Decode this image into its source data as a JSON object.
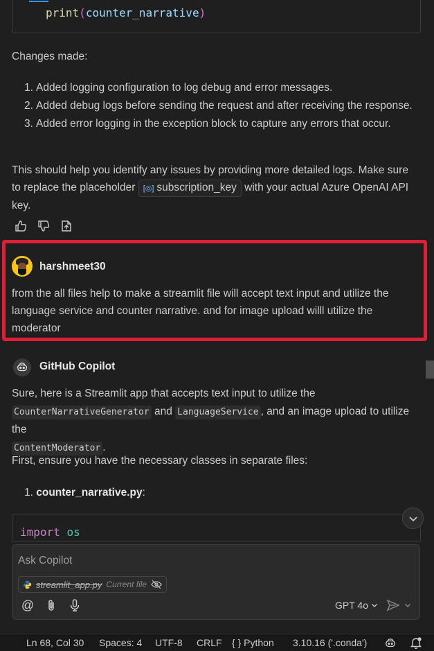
{
  "code_top": {
    "fn": "print",
    "open": "(",
    "arg": "counter_narrative",
    "close": ")"
  },
  "changes_heading": "Changes made:",
  "changes": [
    {
      "num": "1.",
      "text": "Added logging configuration to log debug and error messages."
    },
    {
      "num": "2.",
      "text": "Added debug logs before sending the request and after receiving the response."
    },
    {
      "num": "3.",
      "text": "Added error logging in the exception block to capture any errors that occur."
    }
  ],
  "help_text": {
    "part1": "This should help you identify any issues by providing more detailed logs. Make sure to replace the placeholder",
    "chip": "subscription_key",
    "part2": "with your actual Azure OpenAI API key."
  },
  "user_message": {
    "username": "harshmeet30",
    "text": "from the all files help to make a streamlit file will accept text input and utilize the language service and counter narrative. and for image upload willl utilize the moderator"
  },
  "copilot": {
    "name": "GitHub Copilot",
    "intro_part1": "Sure, here is a Streamlit app that accepts text input to utilize the",
    "code1": "CounterNarrativeGenerator",
    "intro_and": "and",
    "code2": "LanguageService",
    "intro_part2": ", and an image upload to utilize the",
    "code3": "ContentModerator",
    "intro_end": ".",
    "ensure_text": "First, ensure you have the necessary classes in separate files:",
    "file_num": "1.",
    "file_name": "counter_narrative.py",
    "file_colon": ":",
    "code_kw": "import",
    "code_mod": "os"
  },
  "chat_input": {
    "placeholder": "Ask Copilot",
    "file_chip_name": "streamlit_app.py",
    "file_chip_tag": "Current file",
    "model": "GPT 4o"
  },
  "statusbar": {
    "position": "Ln 68, Col 30",
    "spaces": "Spaces: 4",
    "encoding": "UTF-8",
    "eol": "CRLF",
    "language_braces": "{ }",
    "language": "Python",
    "interpreter": "3.10.16 ('.conda')"
  },
  "colors": {
    "highlight_border": "#e01e35",
    "background": "#1f1f1f",
    "accent": "#3794ff"
  }
}
